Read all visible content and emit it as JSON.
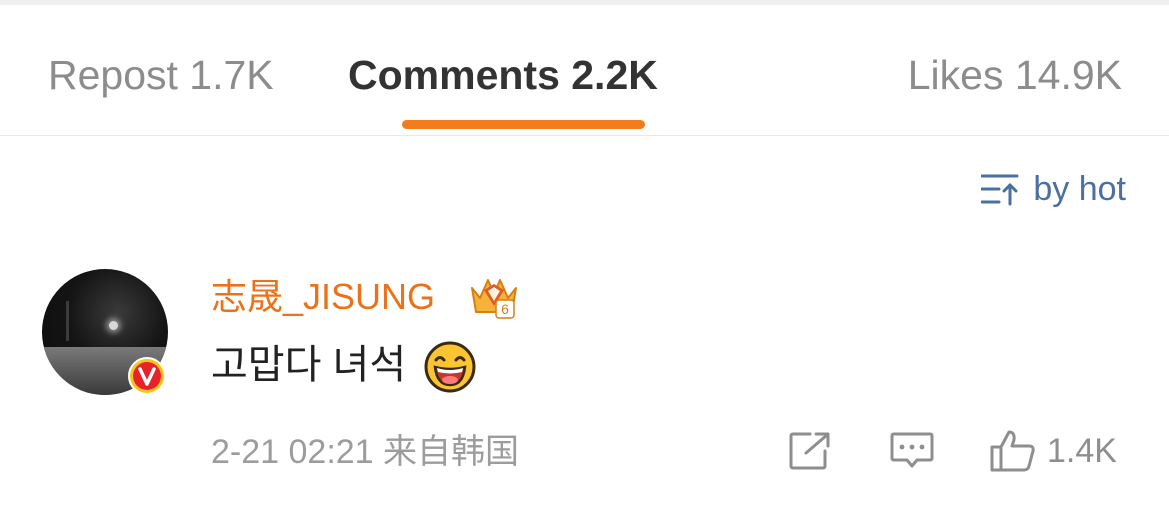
{
  "tabs": {
    "repost": "Repost 1.7K",
    "comments": "Comments 2.2K",
    "likes": "Likes 14.9K"
  },
  "sort": {
    "label": "by hot",
    "icon": "sort-icon"
  },
  "comment": {
    "username": "志晟_JISUNG",
    "text": "고맙다 녀석",
    "emoji": "laughing-emoji",
    "badge": "verified-v-badge",
    "crown": "fan-crown-badge",
    "crown_level": "6",
    "timestamp": "2-21 02:21 来自韩国",
    "like_count": "1.4K"
  },
  "colors": {
    "accent": "#f27e1b",
    "username": "#eb7218",
    "link": "#4a6fa0",
    "muted": "#9c9c9c"
  }
}
